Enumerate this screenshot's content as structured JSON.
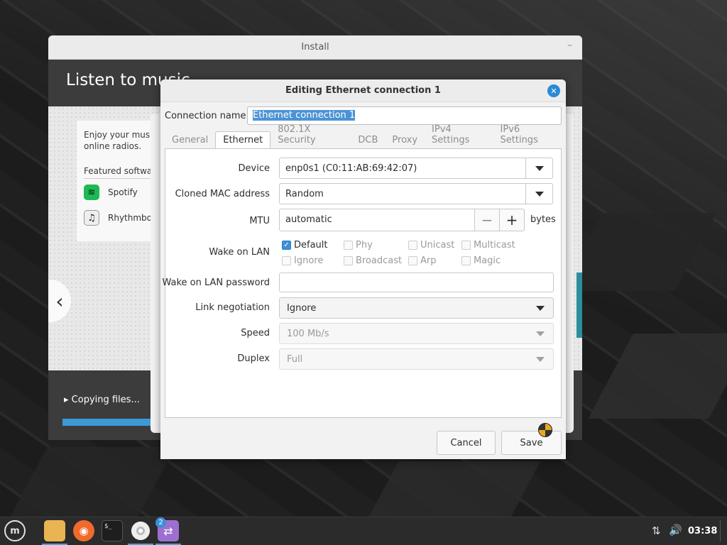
{
  "install_window": {
    "title": "Install",
    "minimize_glyph": "–",
    "heading": "Listen to music",
    "slide_text_line1": "Enjoy your music,",
    "slide_text_line2": "online radios.",
    "featured_label": "Featured software",
    "apps": [
      {
        "name": "Spotify",
        "icon": "spotify-icon"
      },
      {
        "name": "Rhythmbox",
        "icon": "music-note-icon"
      }
    ],
    "prev_glyph": "‹",
    "status": "Copying files...",
    "progress": 0.18
  },
  "dialog": {
    "title": "Editing Ethernet connection 1",
    "close_glyph": "✕",
    "connection_name_label": "Connection name",
    "connection_name_value": "Ethernet connection 1",
    "tabs": [
      {
        "label": "General",
        "active": false
      },
      {
        "label": "Ethernet",
        "active": true
      },
      {
        "label": "802.1X Security",
        "active": false
      },
      {
        "label": "DCB",
        "active": false
      },
      {
        "label": "Proxy",
        "active": false
      },
      {
        "label": "IPv4 Settings",
        "active": false
      },
      {
        "label": "IPv6 Settings",
        "active": false
      }
    ],
    "fields": {
      "device_label": "Device",
      "device_value": "enp0s1 (C0:11:AB:69:42:07)",
      "cloned_mac_label": "Cloned MAC address",
      "cloned_mac_value": "Random",
      "mtu_label": "MTU",
      "mtu_value": "automatic",
      "mtu_minus": "−",
      "mtu_plus": "+",
      "mtu_unit": "bytes",
      "wol_label": "Wake on LAN",
      "wol_options": [
        {
          "label": "Default",
          "checked": true
        },
        {
          "label": "Phy",
          "checked": false
        },
        {
          "label": "Unicast",
          "checked": false
        },
        {
          "label": "Multicast",
          "checked": false
        },
        {
          "label": "Ignore",
          "checked": false
        },
        {
          "label": "Broadcast",
          "checked": false
        },
        {
          "label": "Arp",
          "checked": false
        },
        {
          "label": "Magic",
          "checked": false
        }
      ],
      "wol_password_label": "Wake on LAN password",
      "wol_password_value": "",
      "link_negotiation_label": "Link negotiation",
      "link_negotiation_value": "Ignore",
      "speed_label": "Speed",
      "speed_value": "100 Mb/s",
      "duplex_label": "Duplex",
      "duplex_value": "Full"
    },
    "cancel_label": "Cancel",
    "save_label": "Save"
  },
  "taskbar": {
    "mint_label": "m",
    "terminal_glyph": "$_",
    "firefox_glyph": "◉",
    "transfer_glyph": "⇄",
    "transfer_badge": "2",
    "network_glyph": "⇅",
    "volume_glyph": "🔊",
    "clock": "03:38"
  },
  "colors": {
    "accent": "#3d8fd9",
    "install_header": "#3c3c3c",
    "taskbar": "#2b2b2b"
  }
}
